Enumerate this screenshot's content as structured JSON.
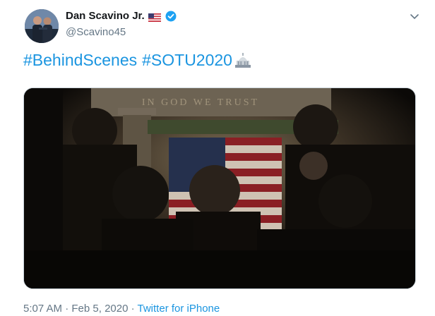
{
  "author": {
    "display_name": "Dan Scavino Jr.",
    "handle": "@Scavino45",
    "verified": true,
    "flag_emoji": "us-flag-icon"
  },
  "tweet": {
    "hashtag1": "#BehindScenes",
    "hashtag2": "#SOTU2020",
    "trailing_emoji": "capitol-building-icon"
  },
  "media": {
    "engraving": "IN GOD WE TRUST"
  },
  "meta": {
    "time": "5:07 AM",
    "sep1": " · ",
    "date": "Feb 5, 2020",
    "sep2": " · ",
    "source": "Twitter for iPhone"
  },
  "colors": {
    "link": "#1b95e0",
    "secondary_text": "#657786",
    "verified": "#1da1f2"
  }
}
